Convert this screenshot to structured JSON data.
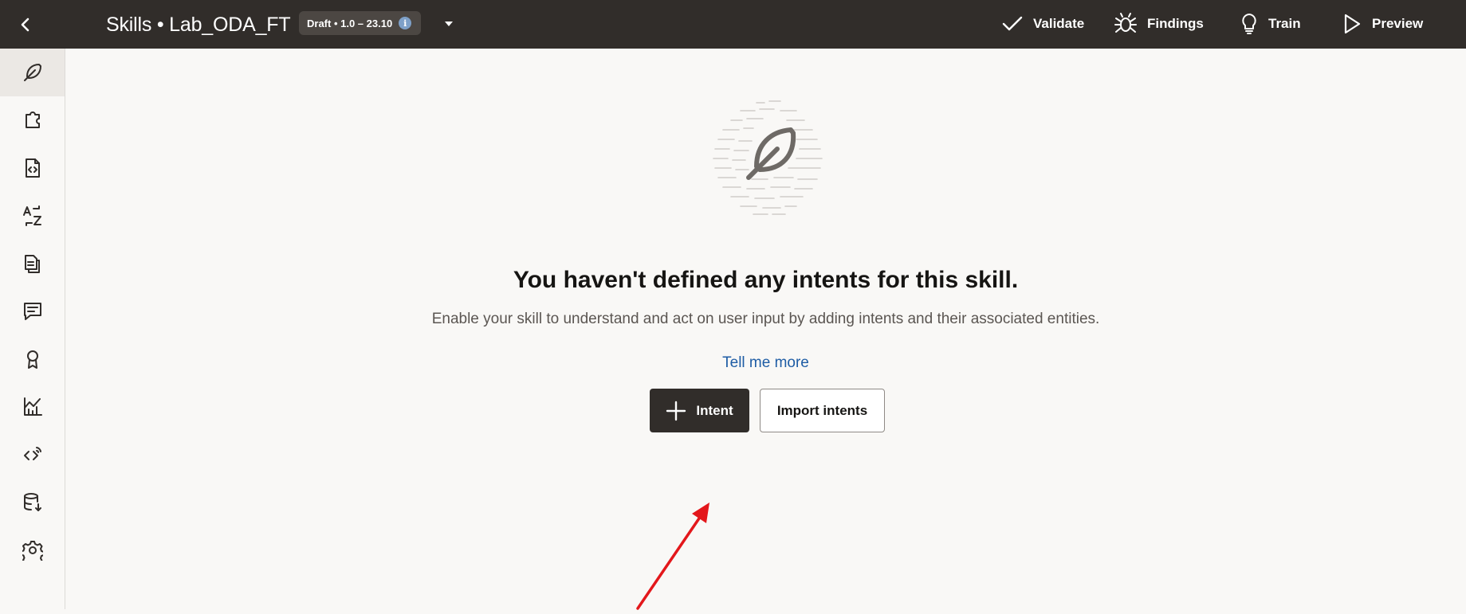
{
  "header": {
    "title": "Skills • Lab_ODA_FT",
    "badge": "Draft • 1.0 – 23.10",
    "info_glyph": "i",
    "actions": [
      {
        "label": "Validate",
        "icon": "check-icon"
      },
      {
        "label": "Findings",
        "icon": "bug-icon"
      },
      {
        "label": "Train",
        "icon": "lightbulb-icon"
      },
      {
        "label": "Preview",
        "icon": "play-icon"
      }
    ]
  },
  "sidebar": {
    "items": [
      {
        "name": "intents",
        "icon": "feather-icon",
        "active": true
      },
      {
        "name": "entities",
        "icon": "puzzle-icon"
      },
      {
        "name": "flows",
        "icon": "code-file-icon"
      },
      {
        "name": "resource-bundles",
        "icon": "translate-icon"
      },
      {
        "name": "components",
        "icon": "documents-icon"
      },
      {
        "name": "conversation",
        "icon": "chat-icon"
      },
      {
        "name": "quality",
        "icon": "ribbon-icon"
      },
      {
        "name": "insights",
        "icon": "chart-icon"
      },
      {
        "name": "channels",
        "icon": "code-signal-icon"
      },
      {
        "name": "data-export",
        "icon": "database-icon"
      },
      {
        "name": "settings",
        "icon": "gear-icon"
      }
    ]
  },
  "empty_state": {
    "heading": "You haven't defined any intents for this skill.",
    "description": "Enable your skill to understand and act on user input by adding intents and their associated entities.",
    "link": "Tell me more",
    "primary_button": "Intent",
    "secondary_button": "Import intents"
  },
  "colors": {
    "header_bg": "#312d2a",
    "page_bg": "#f9f8f6",
    "link": "#1f5da5",
    "annotation_arrow": "#e3171b"
  }
}
